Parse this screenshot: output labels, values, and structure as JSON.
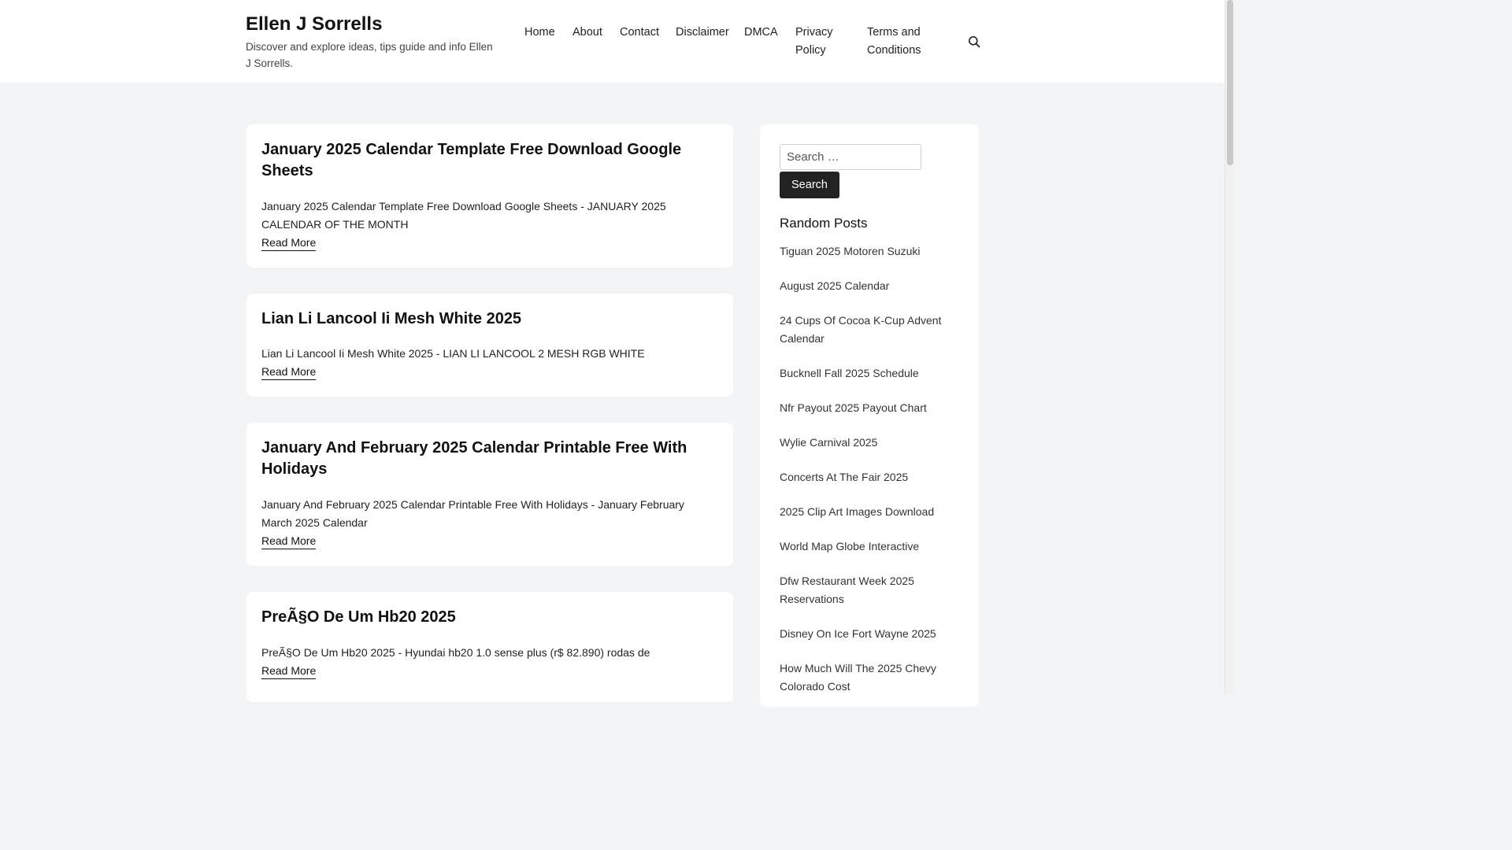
{
  "site": {
    "title": "Ellen J Sorrells",
    "description": "Discover and explore ideas, tips guide and info Ellen J Sorrells."
  },
  "nav": {
    "items": [
      "Home",
      "About",
      "Contact",
      "Disclaimer",
      "DMCA",
      "Privacy Policy",
      "Terms and Conditions"
    ],
    "search_icon": "search-icon"
  },
  "posts": [
    {
      "title": "January 2025 Calendar Template Free Download Google Sheets",
      "excerpt": "January 2025 Calendar Template Free Download Google Sheets - JANUARY 2025 CALENDAR OF THE MONTH",
      "read_more": "Read More"
    },
    {
      "title": "Lian Li Lancool Ii Mesh White 2025",
      "excerpt": "Lian Li Lancool Ii Mesh White 2025 - LIAN LI LANCOOL 2 MESH RGB WHITE",
      "read_more": "Read More"
    },
    {
      "title": "January And February 2025 Calendar Printable Free With Holidays",
      "excerpt": "January And February 2025 Calendar Printable Free With Holidays - January February March 2025 Calendar",
      "read_more": "Read More"
    },
    {
      "title": "PreÃ§O De Um Hb20 2025",
      "excerpt": "PreÃ§O De Um Hb20 2025 - Hyundai hb20 1.0 sense plus (r$ 82.890) rodas de",
      "read_more": "Read More"
    }
  ],
  "sidebar": {
    "search": {
      "placeholder": "Search …",
      "button_label": "Search"
    },
    "random_posts": {
      "title": "Random Posts",
      "items": [
        "Tiguan 2025 Motoren Suzuki",
        "August 2025 Calendar",
        "24 Cups Of Cocoa K-Cup Advent Calendar",
        "Bucknell Fall 2025 Schedule",
        "Nfr Payout 2025 Payout Chart",
        "Wylie Carnival 2025",
        "Concerts At The Fair 2025",
        "2025 Clip Art Images Download",
        "World Map Globe Interactive",
        "Dfw Restaurant Week 2025 Reservations",
        "Disney On Ice Fort Wayne 2025",
        "How Much Will The 2025 Chevy Colorado Cost"
      ]
    }
  }
}
